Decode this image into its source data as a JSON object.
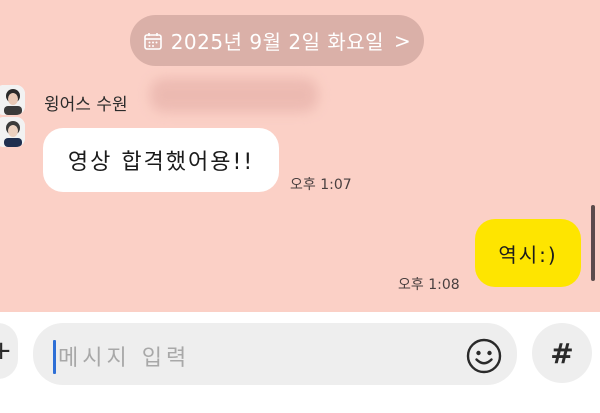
{
  "date_separator": {
    "label": "2025년 9월 2일 화요일",
    "icon": "calendar-icon",
    "chevron": ">"
  },
  "messages": [
    {
      "direction": "incoming",
      "sender": "윙어스 수원",
      "text": "영상 합격했어용!!",
      "time": "오후 1:07"
    },
    {
      "direction": "outgoing",
      "text": "역시:)",
      "time": "오후 1:08"
    }
  ],
  "input_bar": {
    "plus_label": "+",
    "placeholder": "메시지 입력",
    "emoji_icon": "smiley-icon",
    "hash_label": "#"
  },
  "colors": {
    "chat_background": "#fbd0c6",
    "outgoing_bubble": "#fee500",
    "incoming_bubble": "#ffffff",
    "cursor": "#2e6fd6"
  }
}
